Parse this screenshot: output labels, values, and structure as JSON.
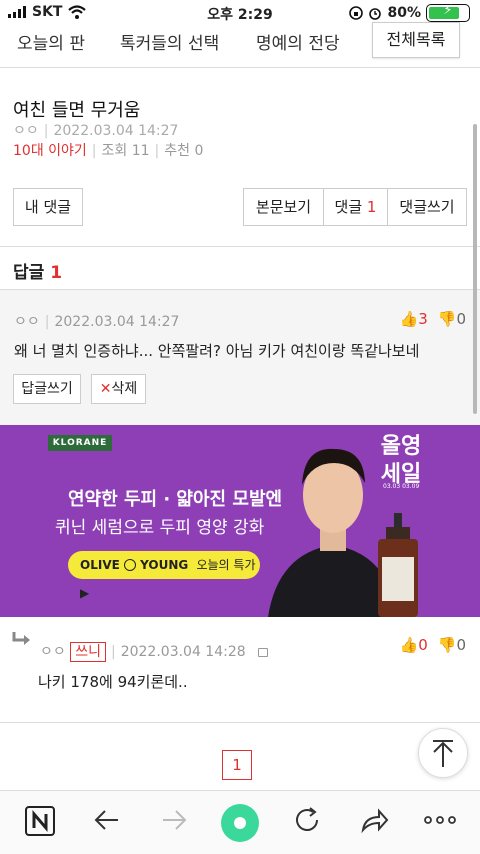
{
  "status_bar": {
    "carrier": "SKT",
    "time": "오후 2:29",
    "battery": "80%",
    "battery_level": 0.8
  },
  "top_nav": {
    "tabs": [
      "오늘의 판",
      "톡커들의 선택",
      "명예의 전당"
    ],
    "all_list_button": "전체목록"
  },
  "post": {
    "title": "여친 들면 무거움",
    "author": "ㅇㅇ",
    "date": "2022.03.04 14:27",
    "category": "10대 이야기",
    "views": "조회 11",
    "recommend": "추천 0"
  },
  "actions": {
    "my_comments": "내 댓글",
    "view_body": "본문보기",
    "comments_label": "댓글",
    "comments_count": "1",
    "write_comment": "댓글쓰기"
  },
  "replies": {
    "label": "답글",
    "count": "1"
  },
  "comment": {
    "author": "ㅇㅇ",
    "date": "2022.03.04 14:27",
    "upvotes": "3",
    "downvotes": "0",
    "text": "왜 너 멸치 인증하냐... 안쪽팔려? 아님 키가 여친이랑 똑같나보네",
    "reply_button": "답글쓰기",
    "delete_button": "삭제"
  },
  "ad": {
    "brand": "KLORANE",
    "line1": "연약한 두피 · 얇아진 모발엔",
    "line2": "퀴닌 세럼으로 두피 영양 강화",
    "store_a": "OLIVE",
    "store_b": "YOUNG",
    "cta": "오늘의 특가",
    "sale_text": "올영 세일",
    "dates": "03.03 03.09"
  },
  "reply": {
    "author": "ㅇㅇ",
    "author_badge": "쓰니",
    "date": "2022.03.04 14:28",
    "upvotes": "0",
    "downvotes": "0",
    "text": "나키 178에 94키론데.."
  },
  "pagination": {
    "current": "1"
  },
  "colors": {
    "accent": "#e03030",
    "ad_bg": "#8f3fb6",
    "home": "#3ad89b"
  }
}
